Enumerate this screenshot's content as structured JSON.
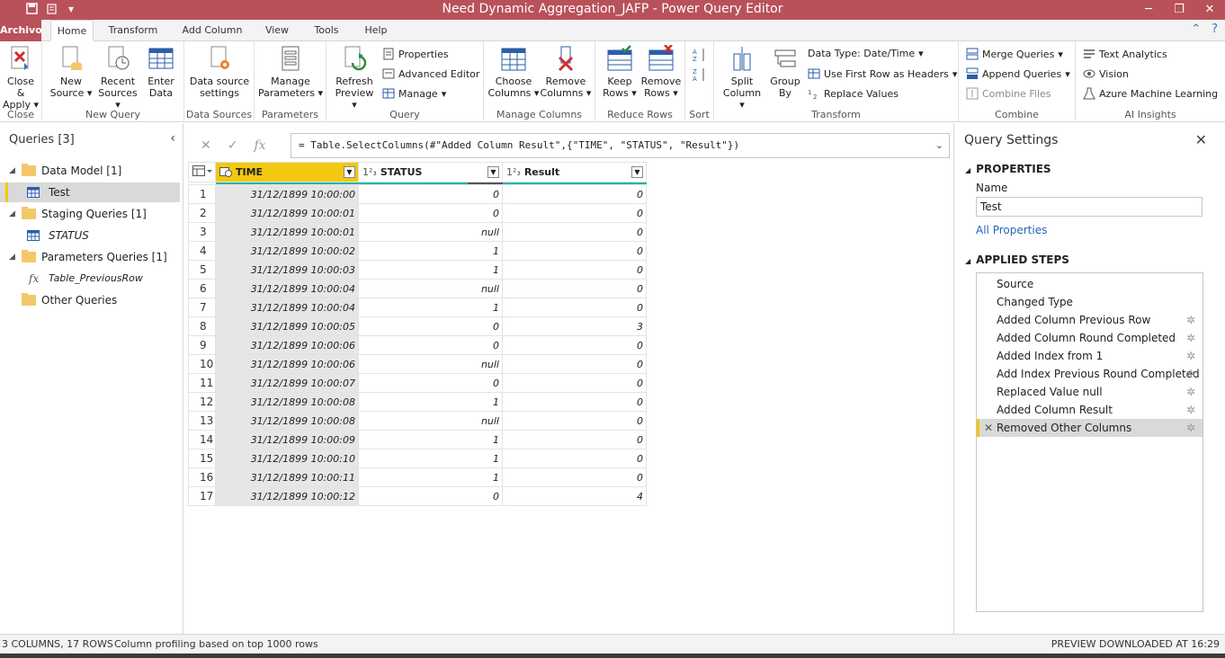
{
  "window": {
    "title": "Need Dynamic Aggregation_JAFP - Power Query Editor",
    "minimize": "─",
    "restore": "❐",
    "close": "✕"
  },
  "tabs": [
    "Archivo",
    "Home",
    "Transform",
    "Add Column",
    "View",
    "Tools",
    "Help"
  ],
  "ribbon": {
    "close_apply": "Close & Apply",
    "new_source": "New Source",
    "recent_sources": "Recent Sources",
    "enter_data": "Enter Data",
    "data_source_settings": "Data source settings",
    "manage_parameters": "Manage Parameters",
    "refresh_preview": "Refresh Preview",
    "properties": "Properties",
    "advanced_editor": "Advanced Editor",
    "manage": "Manage",
    "choose_columns": "Choose Columns",
    "remove_columns": "Remove Columns",
    "keep_rows": "Keep Rows",
    "remove_rows": "Remove Rows",
    "split_column": "Split Column",
    "group_by": "Group By",
    "data_type": "Data Type: Date/Time",
    "use_first_row": "Use First Row as Headers",
    "replace_values": "Replace Values",
    "merge_queries": "Merge Queries",
    "append_queries": "Append Queries",
    "combine_files": "Combine Files",
    "text_analytics": "Text Analytics",
    "vision": "Vision",
    "azure_ml": "Azure Machine Learning",
    "groups": {
      "close": "Close",
      "new_query": "New Query",
      "data_sources": "Data Sources",
      "parameters": "Parameters",
      "query": "Query",
      "manage_columns": "Manage Columns",
      "reduce_rows": "Reduce Rows",
      "sort": "Sort",
      "transform": "Transform",
      "combine": "Combine",
      "ai_insights": "AI Insights"
    }
  },
  "queries_pane": {
    "header": "Queries [3]",
    "items": [
      {
        "label": "Data Model [1]"
      },
      {
        "label": "Test"
      },
      {
        "label": "Staging Queries [1]"
      },
      {
        "label": "STATUS"
      },
      {
        "label": "Parameters Queries [1]"
      },
      {
        "label": "Table_PreviousRow"
      },
      {
        "label": "Other Queries"
      }
    ]
  },
  "formula": "= Table.SelectColumns(#\"Added Column Result\",{\"TIME\", \"STATUS\", \"Result\"})",
  "grid": {
    "columns": [
      {
        "name": "TIME",
        "type": ""
      },
      {
        "name": "STATUS",
        "type": "1²₃"
      },
      {
        "name": "Result",
        "type": "1²₃"
      }
    ],
    "rows": [
      [
        "1",
        "31/12/1899 10:00:00",
        "0",
        "0"
      ],
      [
        "2",
        "31/12/1899 10:00:01",
        "0",
        "0"
      ],
      [
        "3",
        "31/12/1899 10:00:01",
        "null",
        "0"
      ],
      [
        "4",
        "31/12/1899 10:00:02",
        "1",
        "0"
      ],
      [
        "5",
        "31/12/1899 10:00:03",
        "1",
        "0"
      ],
      [
        "6",
        "31/12/1899 10:00:04",
        "null",
        "0"
      ],
      [
        "7",
        "31/12/1899 10:00:04",
        "1",
        "0"
      ],
      [
        "8",
        "31/12/1899 10:00:05",
        "0",
        "3"
      ],
      [
        "9",
        "31/12/1899 10:00:06",
        "0",
        "0"
      ],
      [
        "10",
        "31/12/1899 10:00:06",
        "null",
        "0"
      ],
      [
        "11",
        "31/12/1899 10:00:07",
        "0",
        "0"
      ],
      [
        "12",
        "31/12/1899 10:00:08",
        "1",
        "0"
      ],
      [
        "13",
        "31/12/1899 10:00:08",
        "null",
        "0"
      ],
      [
        "14",
        "31/12/1899 10:00:09",
        "1",
        "0"
      ],
      [
        "15",
        "31/12/1899 10:00:10",
        "1",
        "0"
      ],
      [
        "16",
        "31/12/1899 10:00:11",
        "1",
        "0"
      ],
      [
        "17",
        "31/12/1899 10:00:12",
        "0",
        "4"
      ]
    ]
  },
  "settings": {
    "header": "Query Settings",
    "properties_label": "PROPERTIES",
    "name_label": "Name",
    "name_value": "Test",
    "all_properties": "All Properties",
    "applied_steps_label": "APPLIED STEPS",
    "steps": [
      {
        "label": "Source"
      },
      {
        "label": "Changed Type"
      },
      {
        "label": "Added Column Previous Row"
      },
      {
        "label": "Added Column Round Completed"
      },
      {
        "label": "Added Index from 1"
      },
      {
        "label": "Add Index Previous Round Completed"
      },
      {
        "label": "Replaced Value null"
      },
      {
        "label": "Added Column Result"
      },
      {
        "label": "Removed Other Columns"
      }
    ]
  },
  "status": {
    "left": "3 COLUMNS, 17 ROWS",
    "profiling": "Column profiling based on top 1000 rows",
    "right": "PREVIEW DOWNLOADED AT 16:29"
  },
  "colors": {
    "accent": "#b8515a",
    "highlight": "#f2c811",
    "quality": "#26b3a6"
  }
}
